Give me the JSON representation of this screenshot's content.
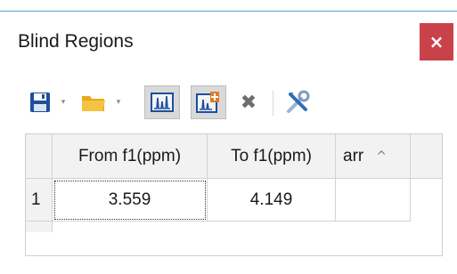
{
  "window": {
    "title": "Blind Regions",
    "close_glyph": "×"
  },
  "toolbar": {
    "buttons": [
      {
        "icon": "save-icon",
        "has_dropdown": true
      },
      {
        "icon": "folder-open-icon",
        "has_dropdown": true
      },
      {
        "icon": "spectrum-select-icon",
        "pressed": true
      },
      {
        "icon": "spectrum-add-region-icon",
        "pressed": true
      },
      {
        "icon": "delete-icon"
      },
      {
        "icon": "tools-icon"
      }
    ],
    "dropdown_glyph": "▾",
    "delete_glyph": "✖"
  },
  "table": {
    "columns": [
      "From f1(ppm)",
      "To f1(ppm)",
      "arr"
    ],
    "sort_caret": "^",
    "rows": [
      {
        "index": "1",
        "from": "3.559",
        "to": "4.149",
        "extra": ""
      }
    ]
  },
  "colors": {
    "close_button": "#c9424a",
    "header_bg": "#f2f2f2",
    "accent_line": "#5aa0c8"
  }
}
